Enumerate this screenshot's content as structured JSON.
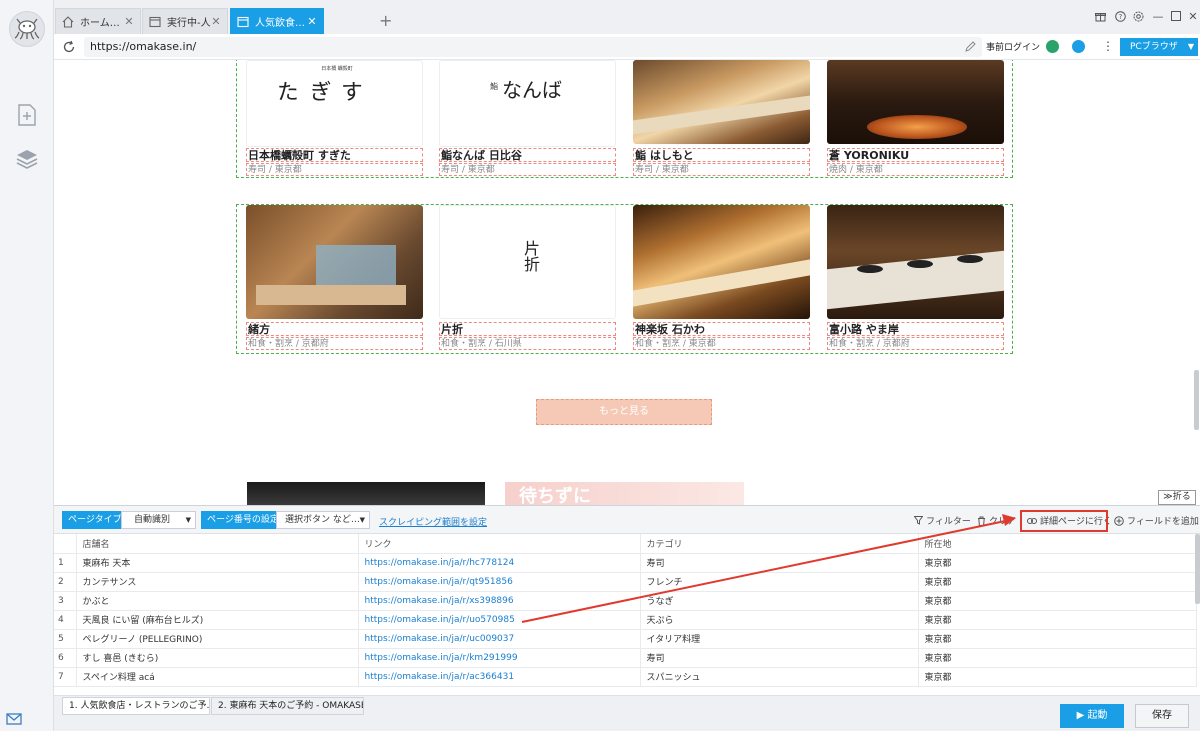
{
  "tabs": [
    {
      "label": "ホーム…",
      "icon": "home-icon"
    },
    {
      "label": "実行中-人…",
      "icon": "window-icon"
    },
    {
      "label": "人気飲食…",
      "icon": "window-icon"
    }
  ],
  "address": {
    "url": "https://omakase.in/",
    "prelogin": "事前ログイン",
    "browser_btn": "PCブラウザ"
  },
  "cards_row1": [
    {
      "name": "日本橋蠣殻町 すぎた",
      "sub": "寿司 / 東京都"
    },
    {
      "name": "鮨なんば 日比谷",
      "sub": "寿司 / 東京都"
    },
    {
      "name": "鮨 はしもと",
      "sub": "寿司 / 東京都"
    },
    {
      "name": "蒼 YORONIKU",
      "sub": "焼肉 / 東京都"
    }
  ],
  "cards_row2": [
    {
      "name": "緒方",
      "sub": "和食・割烹 / 京都府"
    },
    {
      "name": "片折",
      "sub": "和食・割烹 / 石川県"
    },
    {
      "name": "神楽坂 石かわ",
      "sub": "和食・割烹 / 東京都"
    },
    {
      "name": "富小路 やま岸",
      "sub": "和食・割烹 / 京都府"
    }
  ],
  "logo_text": {
    "sugita_small": "日本橋 蠣殻町",
    "sugita_big": "すぎた",
    "namba_prefix": "鮨",
    "namba_big": "なんば",
    "kataori": "片折"
  },
  "more_button": "もっと見る",
  "banner_text": "待ちずに",
  "fold_button": "折る",
  "toolbar": {
    "page_type_label": "ページタイプ",
    "page_type_value": "自動識別",
    "page_num_label": "ページ番号の設定",
    "page_num_value": "選択ボタン など…",
    "scrape_range_link": "スクレイピング範囲を設定",
    "filter": "フィルター",
    "clear": "クリア",
    "detail": "詳細ページに行く",
    "add_field": "フィールドを追加"
  },
  "table": {
    "headers": [
      "店舗名",
      "リンク",
      "カテゴリ",
      "所在地"
    ],
    "rows": [
      {
        "idx": "1",
        "name": "東麻布 天本",
        "link": "https://omakase.in/ja/r/hc778124",
        "cat": "寿司",
        "loc": "東京都"
      },
      {
        "idx": "2",
        "name": "カンテサンス",
        "link": "https://omakase.in/ja/r/qt951856",
        "cat": "フレンチ",
        "loc": "東京都"
      },
      {
        "idx": "3",
        "name": "かぶと",
        "link": "https://omakase.in/ja/r/xs398896",
        "cat": "うなぎ",
        "loc": "東京都"
      },
      {
        "idx": "4",
        "name": "天風良 にい留 (麻布台ヒルズ)",
        "link": "https://omakase.in/ja/r/uo570985",
        "cat": "天ぷら",
        "loc": "東京都"
      },
      {
        "idx": "5",
        "name": "ペレグリーノ (PELLEGRINO)",
        "link": "https://omakase.in/ja/r/uc009037",
        "cat": "イタリア料理",
        "loc": "東京都"
      },
      {
        "idx": "6",
        "name": "すし 喜邑 (きむら)",
        "link": "https://omakase.in/ja/r/km291999",
        "cat": "寿司",
        "loc": "東京都"
      },
      {
        "idx": "7",
        "name": "スペイン料理 acá",
        "link": "https://omakase.in/ja/r/ac366431",
        "cat": "スパニッシュ",
        "loc": "東京都"
      }
    ]
  },
  "page_tabs": [
    "1. 人気飲食店・レストランのご予…",
    "2. 東麻布 天本のご予約 - OMAKASE"
  ],
  "footer": {
    "start": "起動",
    "save": "保存"
  },
  "colors": {
    "accent": "#1a9fe6",
    "highlight": "#e03a2f"
  }
}
